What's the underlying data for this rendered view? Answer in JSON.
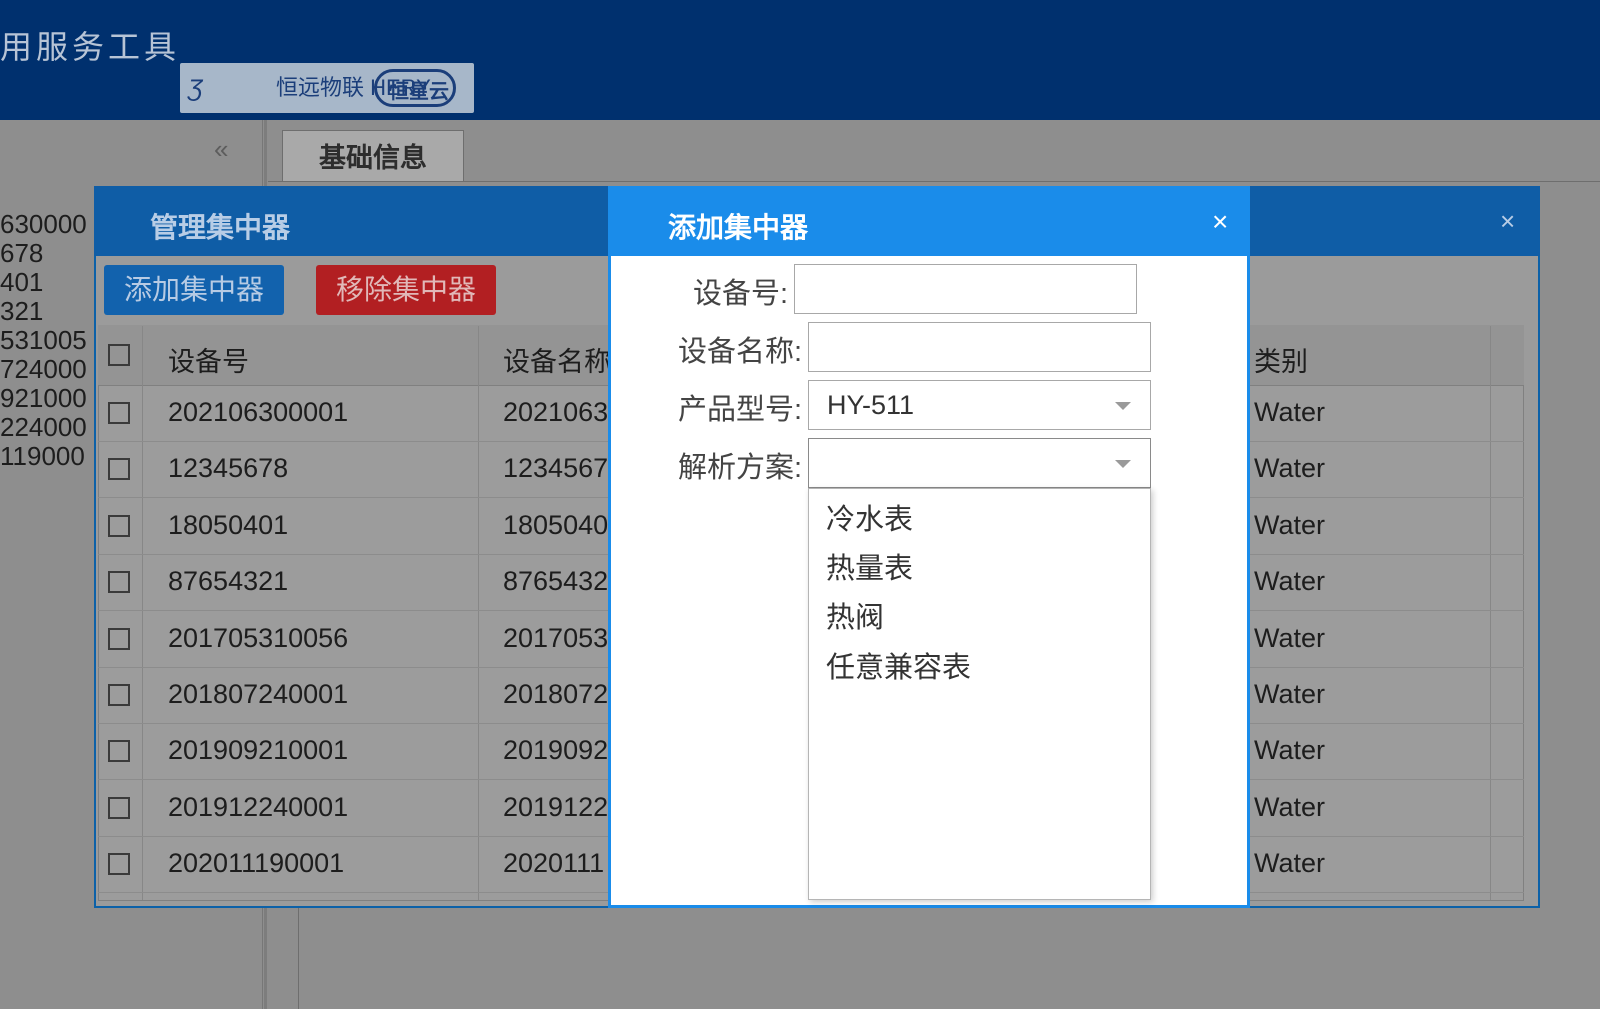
{
  "header": {
    "app_title": "用服务工具",
    "logo_text": "恒远物联 HERY",
    "logo_cloud": "恒星云"
  },
  "left_panel": {
    "collapse_icon": "double-chevron-left-icon",
    "collapse_glyph": "«",
    "lines": [
      "630000",
      "678",
      "401",
      "321",
      "531005",
      "724000",
      "921000",
      "224000",
      "119000"
    ]
  },
  "main": {
    "tab_label": "基础信息"
  },
  "manage_dialog": {
    "title": "管理集中器",
    "close_glyph": "×",
    "add_button": "添加集中器",
    "remove_button": "移除集中器",
    "columns": [
      "设备号",
      "设备名称",
      "类别"
    ],
    "rows": [
      {
        "id": "202106300001",
        "name": "2021063",
        "type": "Water"
      },
      {
        "id": "12345678",
        "name": "1234567",
        "type": "Water"
      },
      {
        "id": "18050401",
        "name": "1805040",
        "type": "Water"
      },
      {
        "id": "87654321",
        "name": "8765432",
        "type": "Water"
      },
      {
        "id": "201705310056",
        "name": "2017053",
        "type": "Water"
      },
      {
        "id": "201807240001",
        "name": "2018072",
        "type": "Water"
      },
      {
        "id": "201909210001",
        "name": "2019092",
        "type": "Water"
      },
      {
        "id": "201912240001",
        "name": "2019122",
        "type": "Water"
      },
      {
        "id": "202011190001",
        "name": "2020111",
        "type": "Water"
      }
    ]
  },
  "add_dialog": {
    "title": "添加集中器",
    "close_glyph": "×",
    "fields": {
      "device_no_label": "设备号:",
      "device_no_value": "",
      "device_name_label": "设备名称:",
      "device_name_value": "",
      "product_model_label": "产品型号:",
      "product_model_value": "HY-511",
      "parse_scheme_label": "解析方案:",
      "parse_scheme_value": ""
    },
    "scheme_options": [
      "冷水表",
      "热量表",
      "热阀",
      "任意兼容表"
    ]
  },
  "colors": {
    "header_bg": "#00306e",
    "dialog_blue": "#1a8cea",
    "add_btn": "#1262ad",
    "remove_btn": "#b21f22"
  }
}
